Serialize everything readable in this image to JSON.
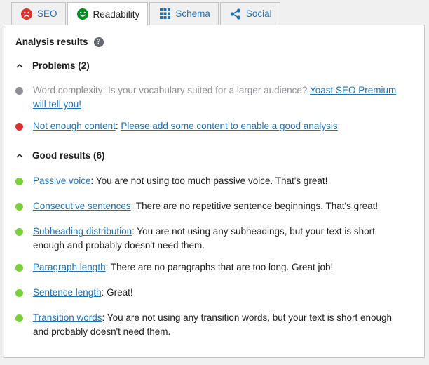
{
  "tabs": [
    {
      "label": "SEO",
      "icon": "sad-face-icon",
      "color": "#dc3232"
    },
    {
      "label": "Readability",
      "icon": "happy-face-icon",
      "color": "#008a20"
    },
    {
      "label": "Schema",
      "icon": "grid-icon",
      "color": "#2271b1"
    },
    {
      "label": "Social",
      "icon": "share-icon",
      "color": "#2271b1"
    }
  ],
  "analysis": {
    "title": "Analysis results"
  },
  "problems": {
    "title": "Problems (2)",
    "items": [
      {
        "pre": "Word complexity: Is your vocabulary suited for a larger audience? ",
        "link": "Yoast SEO Premium will tell you!",
        "color": "#8c8f94"
      },
      {
        "link1": "Not enough content",
        "mid": ": ",
        "link2": "Please add some content to enable a good analysis",
        "post": ".",
        "color": "#dc3232"
      }
    ]
  },
  "good": {
    "title": "Good results (6)",
    "items": [
      {
        "link": "Passive voice",
        "text": ": You are not using too much passive voice. That's great!",
        "color": "#7ad03a"
      },
      {
        "link": "Consecutive sentences",
        "text": ": There are no repetitive sentence beginnings. That's great!",
        "color": "#7ad03a"
      },
      {
        "link": "Subheading distribution",
        "text": ": You are not using any subheadings, but your text is short enough and probably doesn't need them.",
        "color": "#7ad03a"
      },
      {
        "link": "Paragraph length",
        "text": ": There are no paragraphs that are too long. Great job!",
        "color": "#7ad03a"
      },
      {
        "link": "Sentence length",
        "text": ": Great!",
        "color": "#7ad03a"
      },
      {
        "link": "Transition words",
        "text": ": You are not using any transition words, but your text is short enough and probably doesn't need them.",
        "color": "#7ad03a"
      }
    ]
  }
}
